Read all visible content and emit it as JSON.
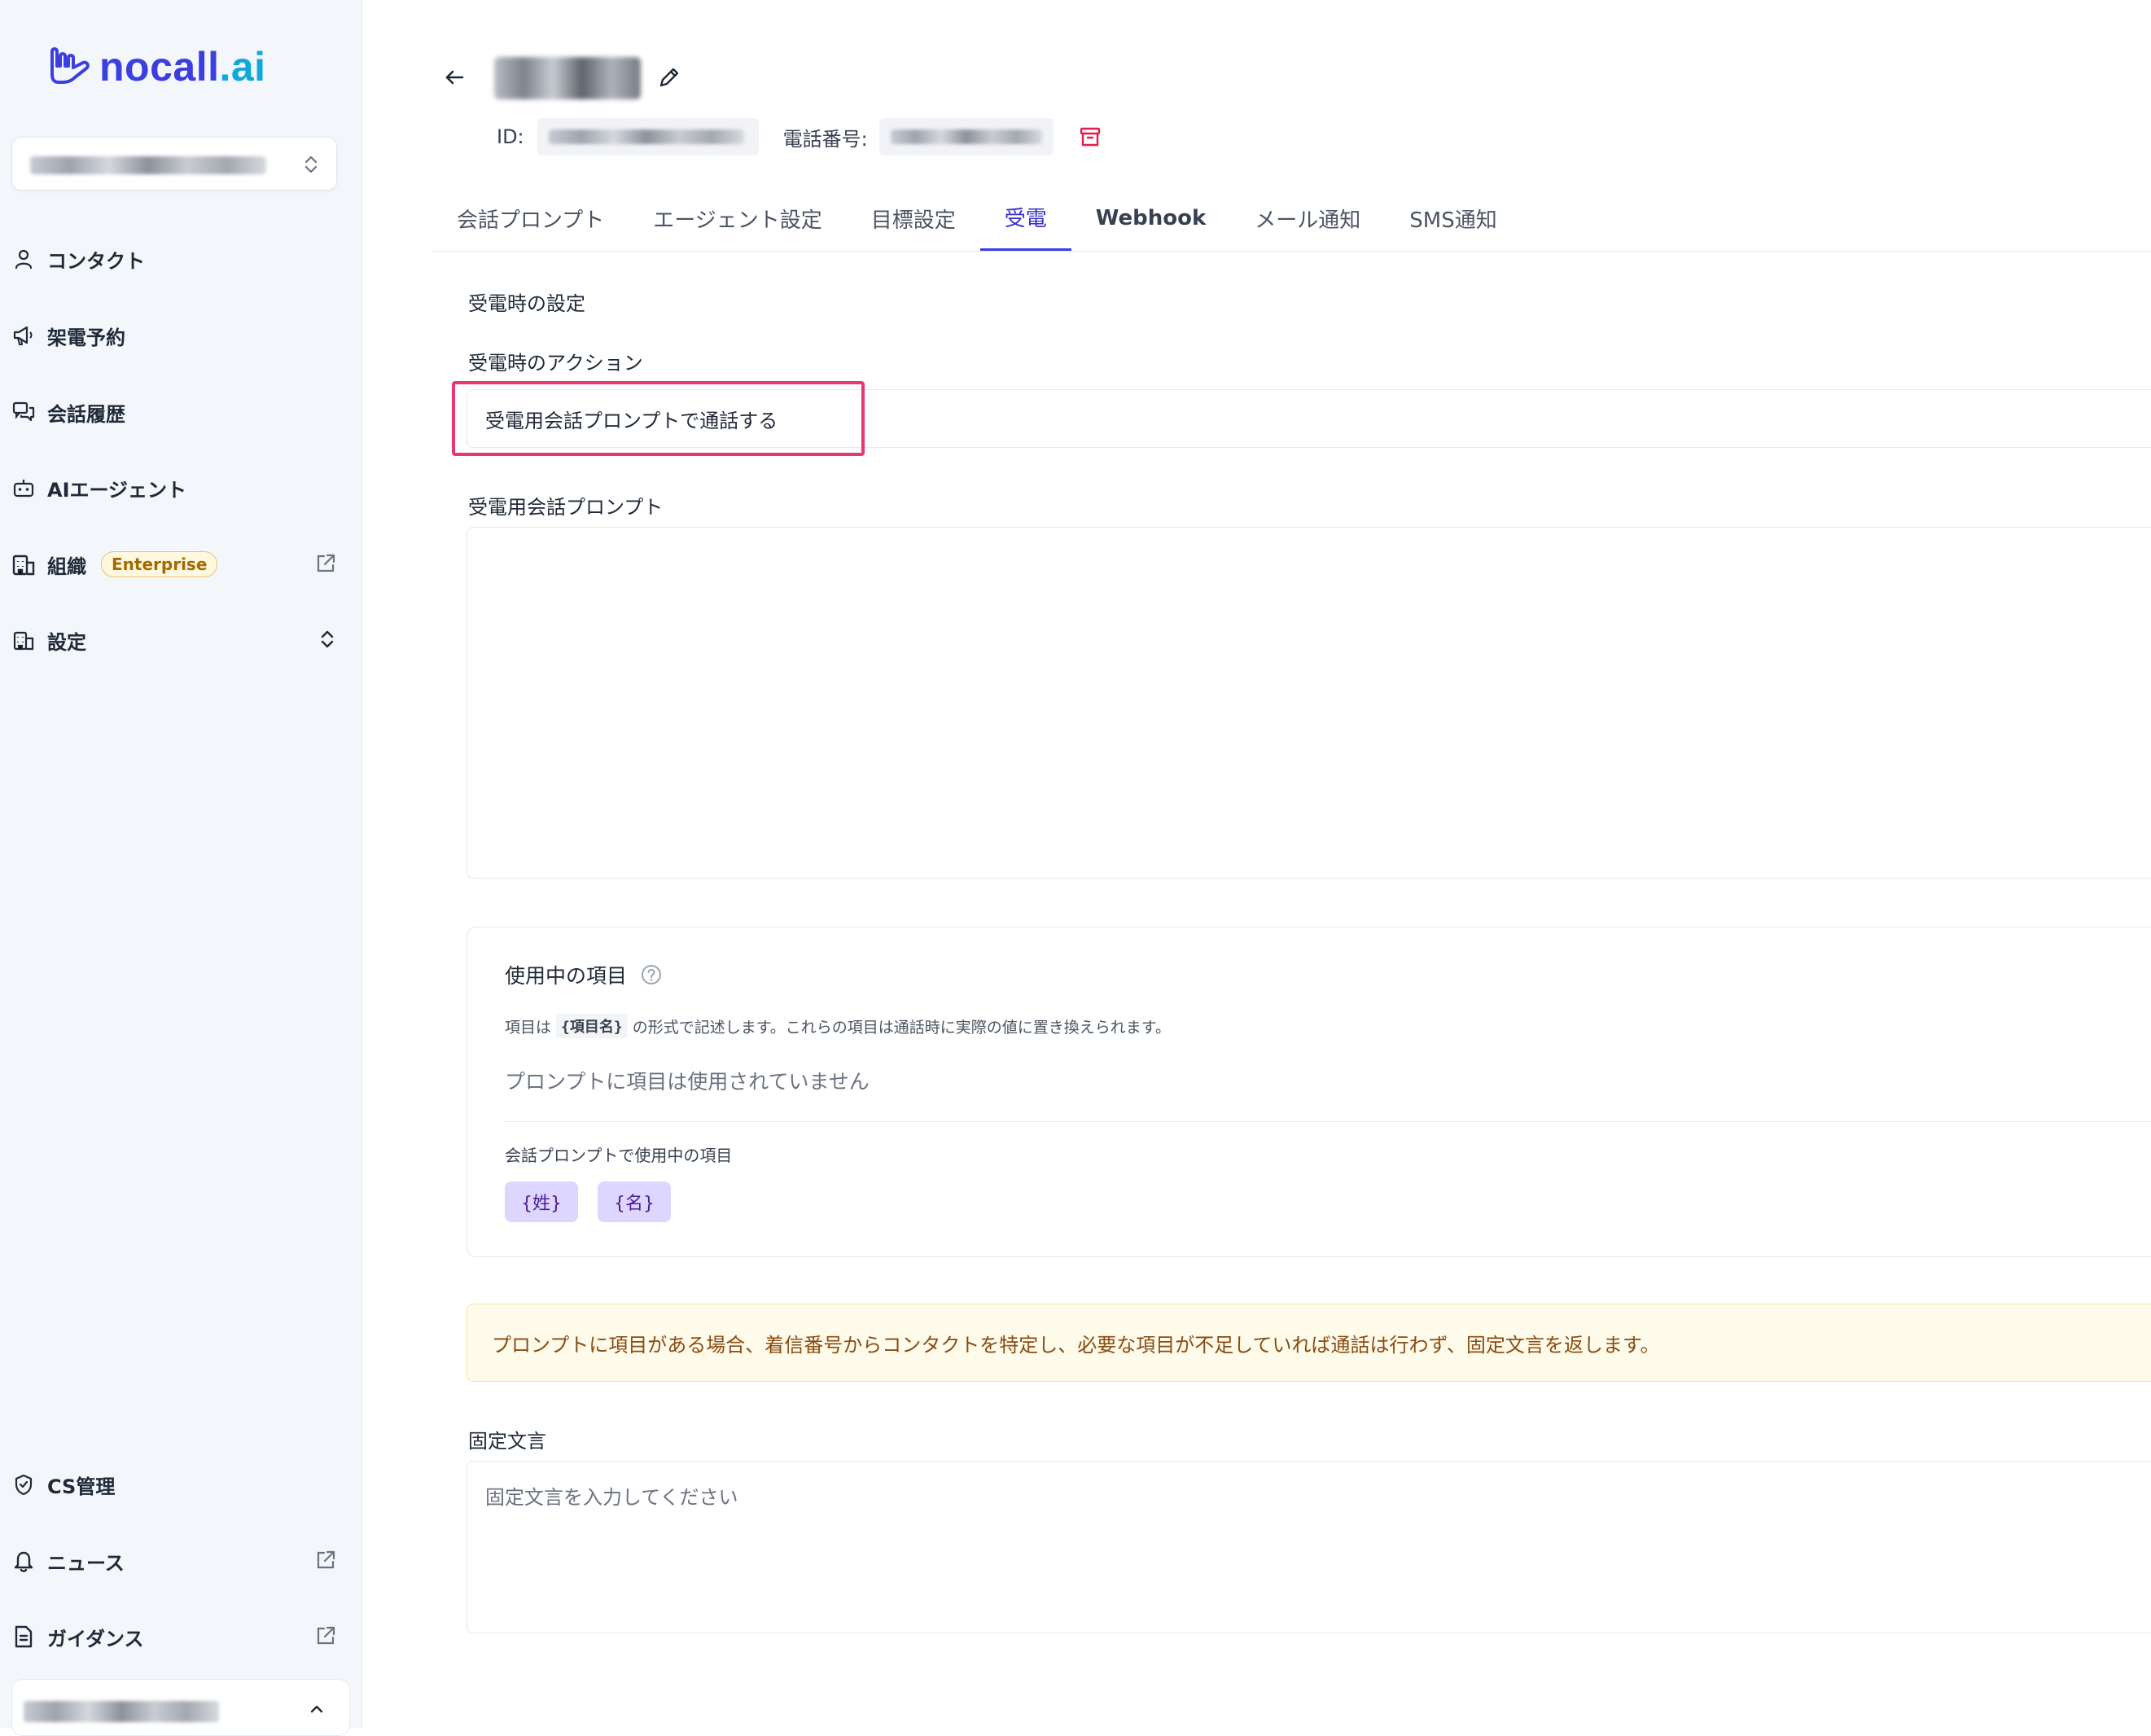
{
  "brand": {
    "logo_text_main": "nocall",
    "logo_text_suffix": ".ai",
    "logo_color": "#3b3fe0",
    "logo_accent": "#0fa8dc"
  },
  "sidebar": {
    "nav_items": [
      {
        "label": "コンタクト",
        "icon": "user-icon"
      },
      {
        "label": "架電予約",
        "icon": "megaphone-icon"
      },
      {
        "label": "会話履歴",
        "icon": "chat-icon"
      },
      {
        "label": "AIエージェント",
        "icon": "bot-icon"
      },
      {
        "label": "組織",
        "icon": "building-icon",
        "badge": "Enterprise"
      },
      {
        "label": "設定",
        "icon": "building-icon"
      }
    ],
    "bottom_items": [
      {
        "label": "CS管理",
        "icon": "shield-icon"
      },
      {
        "label": "ニュース",
        "icon": "bell-icon"
      },
      {
        "label": "ガイダンス",
        "icon": "document-icon"
      }
    ]
  },
  "header": {
    "id_label": "ID:",
    "phone_label": "電話番号:"
  },
  "tabs": [
    {
      "label": "会話プロンプト"
    },
    {
      "label": "エージェント設定"
    },
    {
      "label": "目標設定"
    },
    {
      "label": "受電",
      "active": true
    },
    {
      "label": "Webhook"
    },
    {
      "label": "メール通知"
    },
    {
      "label": "SMS通知"
    }
  ],
  "form": {
    "settings_title": "受電時の設定",
    "action_label": "受電時のアクション",
    "action_value": "受電用会話プロンプトで通話する",
    "prompt_label": "受電用会話プロンプト",
    "prompt_value": "",
    "fixed_label": "固定文言",
    "fixed_placeholder": "固定文言を入力してください"
  },
  "variables": {
    "title": "使用中の項目",
    "desc_prefix": "項目は",
    "desc_code": "{項目名}",
    "desc_suffix": "の形式で記述します。これらの項目は通話時に実際の値に置き換えられます。",
    "empty_text": "プロンプトに項目は使用されていません",
    "sub_title": "会話プロンプトで使用中の項目",
    "chips": [
      "{姓}",
      "{名}"
    ]
  },
  "notice": {
    "text": "プロンプトに項目がある場合、着信番号からコンタクトを特定し、必要な項目が不足していれば通話は行わず、固定文言を返します。",
    "color": "#8a4b12"
  },
  "colors": {
    "accent": "#3b3fe0",
    "highlight": "#e8386d",
    "danger": "#e11d48"
  }
}
